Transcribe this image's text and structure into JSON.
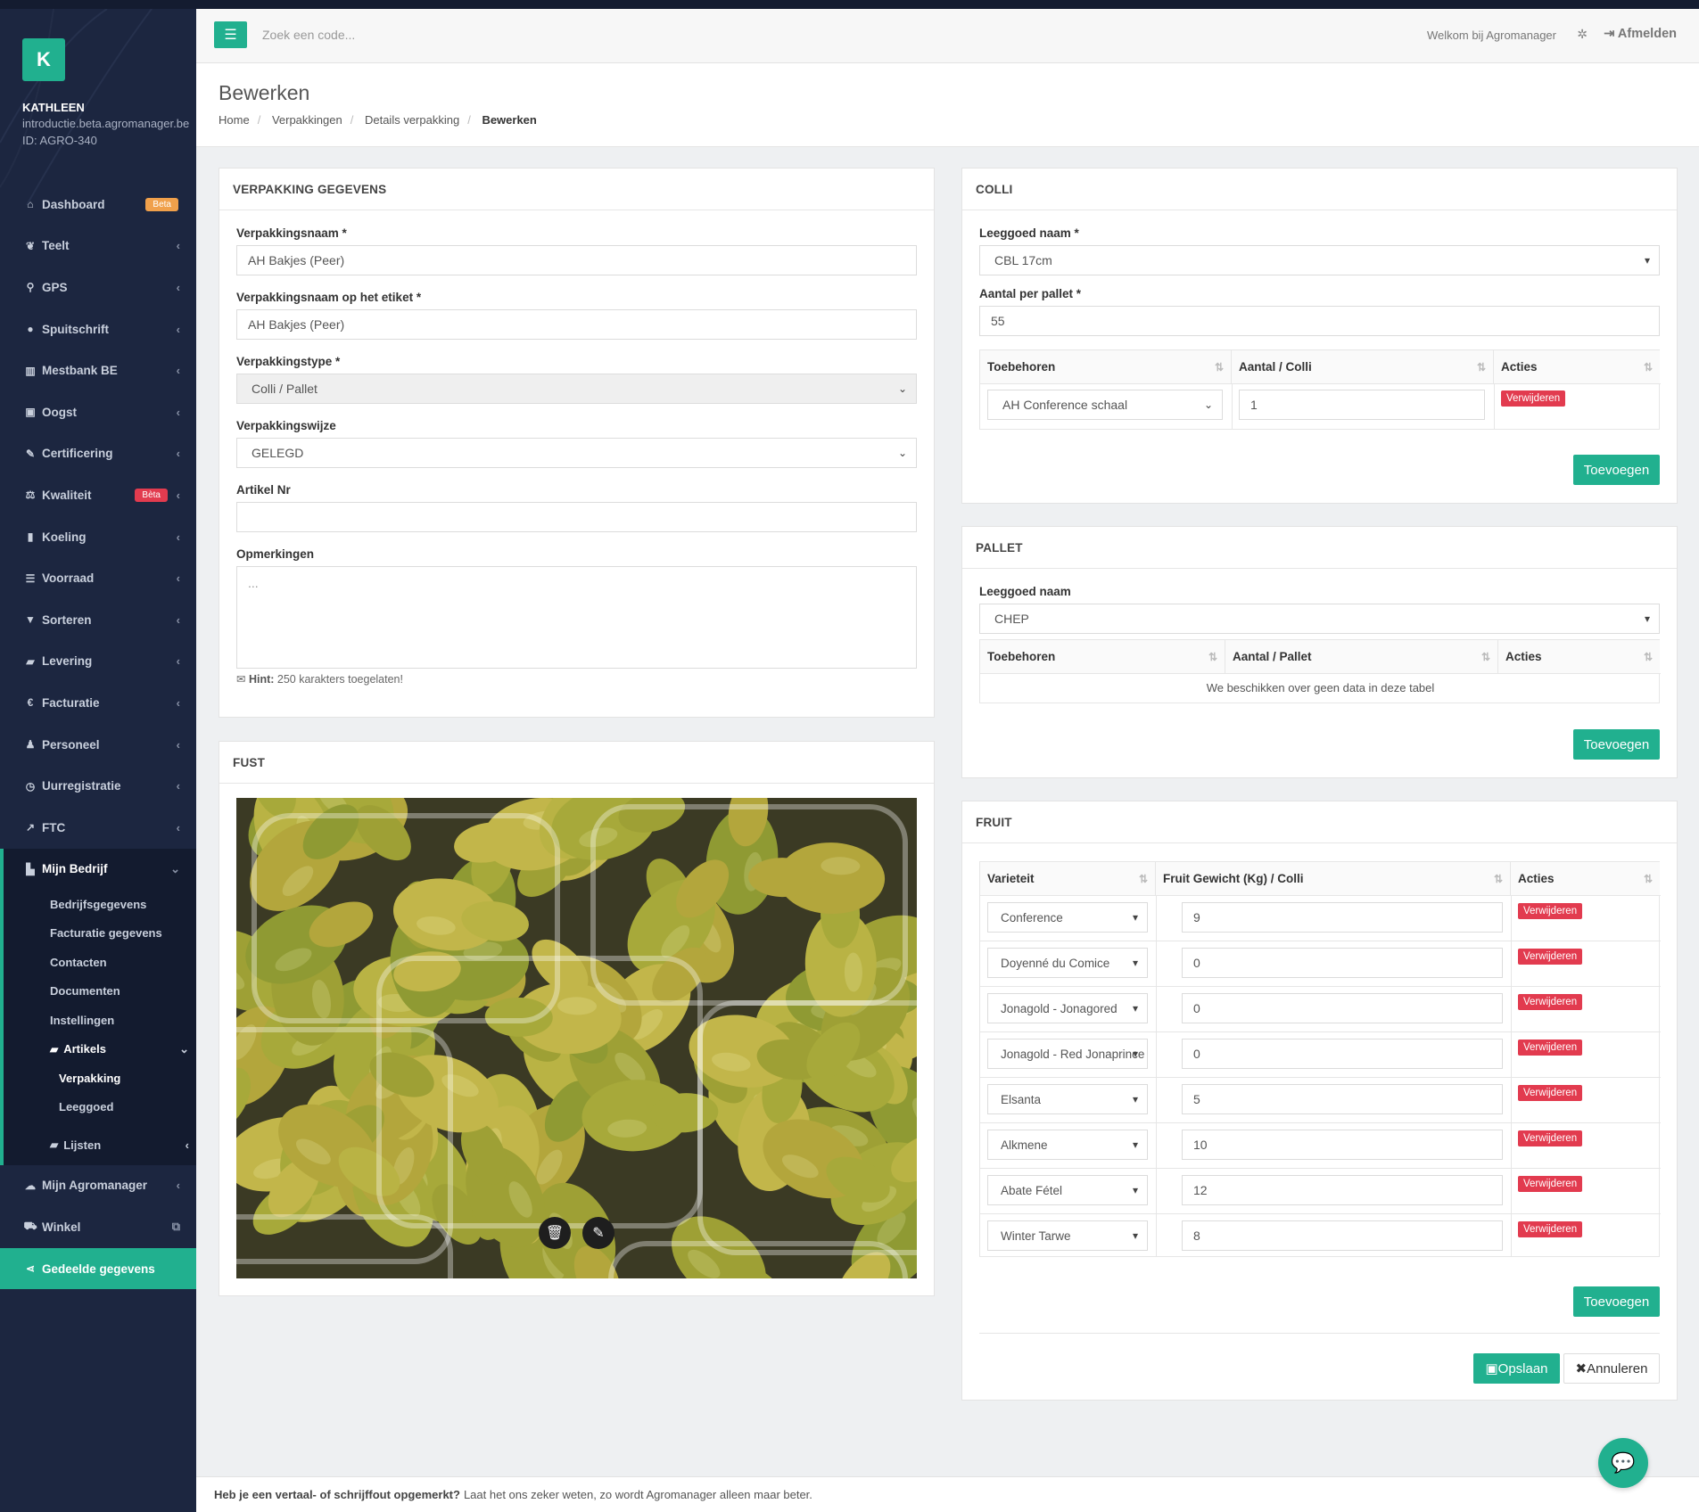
{
  "user": {
    "initial": "K",
    "name": "KATHLEEN",
    "email": "introductie.beta.agromanager.be",
    "id": "ID: AGRO-340"
  },
  "nav": [
    {
      "label": "Dashboard",
      "icon": "home-icon",
      "glyph": "⌂",
      "badge": "Beta",
      "badge_color": "#f0a04b"
    },
    {
      "label": "Teelt",
      "icon": "leaf-icon",
      "glyph": "❦"
    },
    {
      "label": "GPS",
      "icon": "map-marker-icon",
      "glyph": "⚲"
    },
    {
      "label": "Spuitschrift",
      "icon": "drop-icon",
      "glyph": "●"
    },
    {
      "label": "Mestbank BE",
      "icon": "bank-icon",
      "glyph": "▥"
    },
    {
      "label": "Oogst",
      "icon": "basket-icon",
      "glyph": "▣"
    },
    {
      "label": "Certificering",
      "icon": "certificate-icon",
      "glyph": "✎"
    },
    {
      "label": "Kwaliteit",
      "icon": "balance-scale-icon",
      "glyph": "⚖",
      "badge": "Bèta",
      "badge_color": "#e23b4f"
    },
    {
      "label": "Koeling",
      "icon": "thermometer-icon",
      "glyph": "▮"
    },
    {
      "label": "Voorraad",
      "icon": "list-icon",
      "glyph": "☰"
    },
    {
      "label": "Sorteren",
      "icon": "filter-icon",
      "glyph": "▼"
    },
    {
      "label": "Levering",
      "icon": "truck-icon",
      "glyph": "▰"
    },
    {
      "label": "Facturatie",
      "icon": "euro-icon",
      "glyph": "€"
    },
    {
      "label": "Personeel",
      "icon": "user-icon",
      "glyph": "♟"
    },
    {
      "label": "Uurregistratie",
      "icon": "clock-icon",
      "glyph": "◷"
    },
    {
      "label": "FTC",
      "icon": "line-chart-icon",
      "glyph": "↗"
    }
  ],
  "mine": {
    "label": "Mijn Bedrijf",
    "items": [
      "Bedrijfsgegevens",
      "Facturatie gegevens",
      "Contacten",
      "Documenten",
      "Instellingen"
    ],
    "artikels": "Artikels",
    "artikel_items": [
      "Verpakking",
      "Leeggoed"
    ],
    "lijsten": "Lijsten"
  },
  "nav_bottom": [
    {
      "label": "Mijn Agromanager"
    },
    {
      "label": "Winkel"
    },
    {
      "label": "Gedeelde gegevens"
    }
  ],
  "topbar": {
    "search_placeholder": "Zoek een code...",
    "welcome": "Welkom bij Agromanager",
    "logout": "Afmelden"
  },
  "page": {
    "title": "Bewerken",
    "breadcrumb": [
      "Home",
      "Verpakkingen",
      "Details verpakking",
      "Bewerken"
    ]
  },
  "form": {
    "title": "VERPAKKING GEGEVENS",
    "name_label": "Verpakkingsnaam *",
    "name_value": "AH Bakjes (Peer)",
    "label_label": "Verpakkingsnaam op het etiket *",
    "label_value": "AH Bakjes (Peer)",
    "type_label": "Verpakkingstype *",
    "type_value": "Colli / Pallet",
    "wijze_label": "Verpakkingswijze",
    "wijze_value": "GELEGD",
    "artikel_label": "Artikel Nr",
    "artikel_value": "",
    "opm_label": "Opmerkingen",
    "opm_placeholder": "...",
    "hint_bold": "Hint:",
    "hint_text": "250 karakters toegelaten!"
  },
  "fust": {
    "title": "FUST"
  },
  "colli": {
    "title": "COLLI",
    "leeg_label": "Leeggoed naam *",
    "leeg_value": "CBL 17cm",
    "aantal_label": "Aantal per pallet *",
    "aantal_value": "55",
    "headers": [
      "Toebehoren",
      "Aantal / Colli",
      "Acties"
    ],
    "row": {
      "toebehoren": "AH Conference schaal",
      "aantal": "1",
      "action": "Verwijderen"
    },
    "add": "Toevoegen"
  },
  "pallet": {
    "title": "PALLET",
    "leeg_label": "Leeggoed naam",
    "leeg_value": "CHEP",
    "headers": [
      "Toebehoren",
      "Aantal / Pallet",
      "Acties"
    ],
    "empty": "We beschikken over geen data in deze tabel",
    "add": "Toevoegen"
  },
  "fruit": {
    "title": "FRUIT",
    "headers": [
      "Varieteit",
      "Fruit Gewicht (Kg) / Colli",
      "Acties"
    ],
    "rows": [
      {
        "variety": "Conference",
        "weight": "9"
      },
      {
        "variety": "Doyenné du Comice",
        "weight": "0"
      },
      {
        "variety": "Jonagold - Jonagored",
        "weight": "0"
      },
      {
        "variety": "Jonagold - Red Jonaprince",
        "weight": "0"
      },
      {
        "variety": "Elsanta",
        "weight": "5"
      },
      {
        "variety": "Alkmene",
        "weight": "10"
      },
      {
        "variety": "Abate Fétel",
        "weight": "12"
      },
      {
        "variety": "Winter Tarwe",
        "weight": "8"
      }
    ],
    "action": "Verwijderen",
    "add": "Toevoegen",
    "save": "Opslaan",
    "cancel": "Annuleren"
  },
  "footer": {
    "bold": "Heb je een vertaal- of schrijffout opgemerkt?",
    "text": "Laat het ons zeker weten, zo wordt Agromanager alleen maar beter."
  },
  "colors": {
    "accent": "#21b08f",
    "sidebar": "#1c2640",
    "danger": "#e23b4f",
    "warning": "#f0a04b"
  }
}
